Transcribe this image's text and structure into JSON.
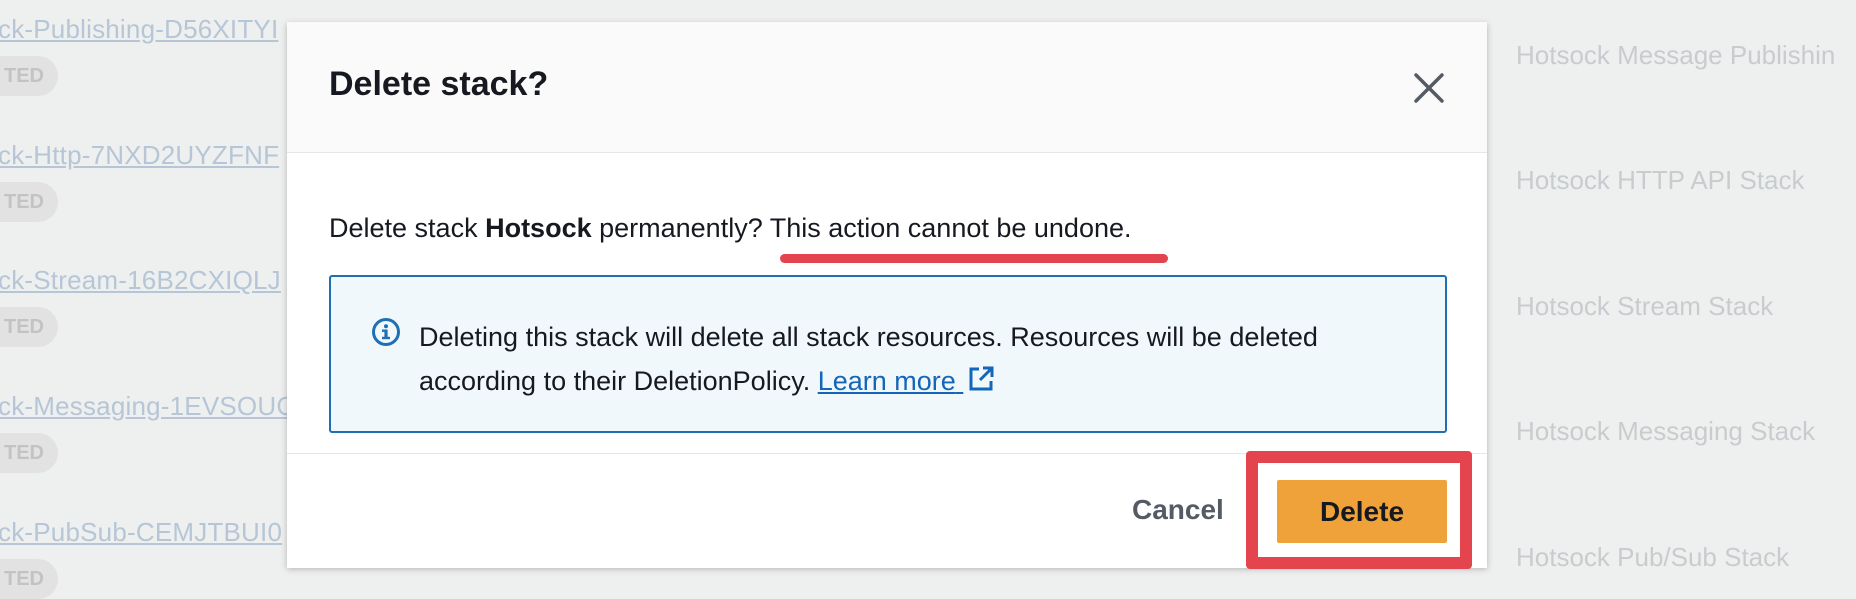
{
  "background": {
    "left_rows": [
      {
        "link": "ck-Publishing-D56XITYI",
        "badge": "TED"
      },
      {
        "link": "ck-Http-7NXD2UYZFNF",
        "badge": "TED"
      },
      {
        "link": "ck-Stream-16B2CXIQLJ",
        "badge": "TED"
      },
      {
        "link": "ck-Messaging-1EVSOUC",
        "badge": "TED"
      },
      {
        "link": "ck-PubSub-CEMJTBUI0",
        "badge": "TED"
      }
    ],
    "right_rows": [
      "Hotsock Message Publishin",
      "Hotsock HTTP API Stack",
      "Hotsock Stream Stack",
      "Hotsock Messaging Stack",
      "Hotsock Pub/Sub Stack"
    ]
  },
  "modal": {
    "title": "Delete stack?",
    "close_icon": "close-icon",
    "message": {
      "prefix": "Delete stack ",
      "stack_name": "Hotsock",
      "middle": " permanently? ",
      "warning": "This action cannot be undone",
      "suffix": "."
    },
    "info": {
      "icon": "info-icon",
      "text": "Deleting this stack will delete all stack resources. Resources will be deleted according to their DeletionPolicy. ",
      "link_label": "Learn more",
      "link_icon": "external-link-icon"
    },
    "footer": {
      "cancel_label": "Cancel",
      "delete_label": "Delete"
    }
  },
  "colors": {
    "annotation_red": "#e4444d",
    "primary_orange": "#f0a23a",
    "info_blue": "#1f6fb5",
    "link_blue": "#1466b8"
  }
}
